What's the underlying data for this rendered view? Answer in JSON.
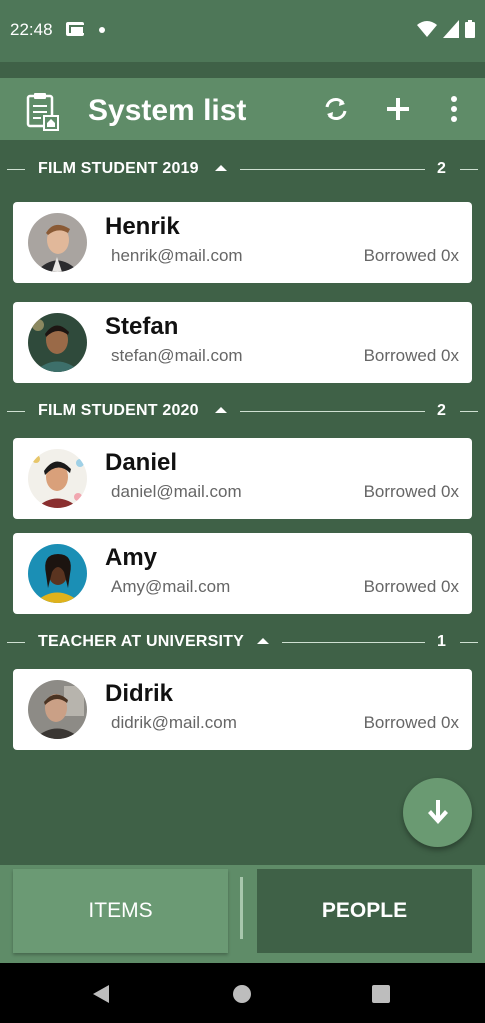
{
  "status_bar": {
    "time": "22:48",
    "icons": [
      "mail-icon",
      "notification-dot-icon",
      "wifi-icon",
      "signal-icon",
      "battery-icon"
    ]
  },
  "app_bar": {
    "title": "System list",
    "icons": [
      "clipboard-logo-icon",
      "sync-icon",
      "add-icon",
      "more-vert-icon"
    ]
  },
  "groups": [
    {
      "title": "FILM STUDENT 2019",
      "count": "2",
      "people": [
        {
          "name": "Henrik",
          "email": "henrik@mail.com",
          "borrowed": "Borrowed 0x"
        },
        {
          "name": "Stefan",
          "email": "stefan@mail.com",
          "borrowed": "Borrowed 0x"
        }
      ]
    },
    {
      "title": "FILM STUDENT 2020",
      "count": "2",
      "people": [
        {
          "name": "Daniel",
          "email": "daniel@mail.com",
          "borrowed": "Borrowed 0x"
        },
        {
          "name": "Amy",
          "email": "Amy@mail.com",
          "borrowed": "Borrowed 0x"
        }
      ]
    },
    {
      "title": "TEACHER AT UNIVERSITY",
      "count": "1",
      "people": [
        {
          "name": "Didrik",
          "email": "didrik@mail.com",
          "borrowed": "Borrowed 0x"
        }
      ]
    }
  ],
  "bottom_tabs": {
    "items_label": "ITEMS",
    "people_label": "PEOPLE",
    "selected": "PEOPLE"
  },
  "colors": {
    "primary": "#5f8c68",
    "background": "#3f6147",
    "accent": "#6a9a72"
  }
}
